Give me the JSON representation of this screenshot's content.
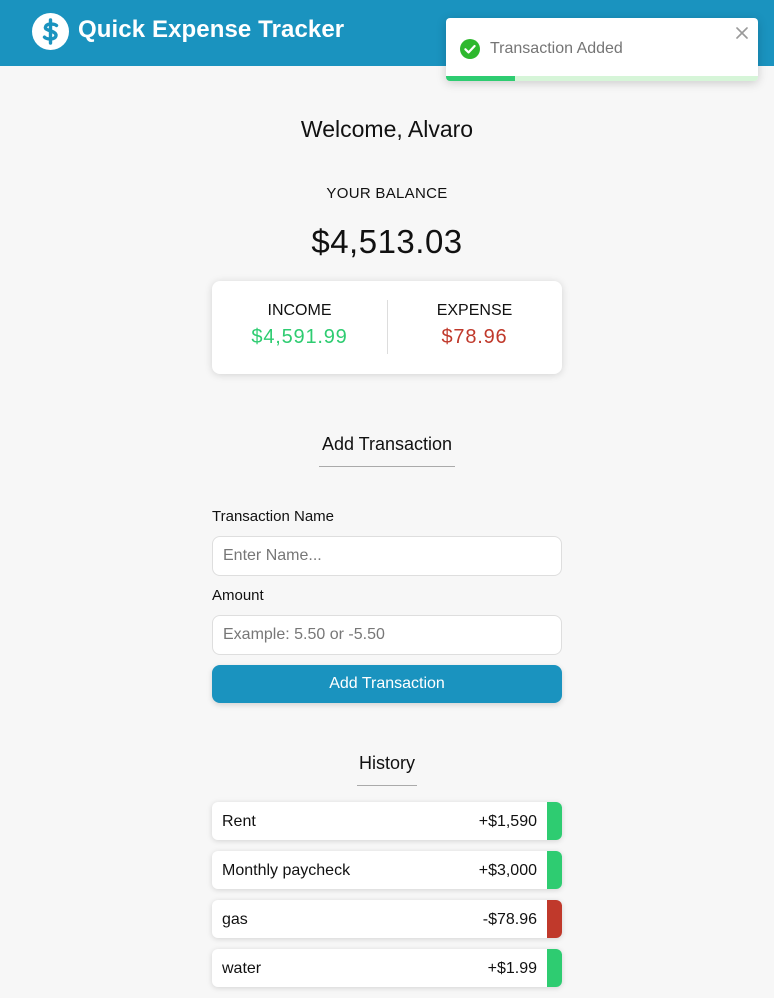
{
  "header": {
    "title": "Quick Expense Tracker",
    "logo_icon": "dollar-sign-icon",
    "color": "#1a93bf"
  },
  "toast": {
    "message": "Transaction Added",
    "icon": "check-circle-icon",
    "close_icon": "close-icon",
    "progress": 0.22,
    "accent": "#2ecc71"
  },
  "welcome": "Welcome, Alvaro",
  "balance": {
    "label": "YOUR BALANCE",
    "value": "$4,513.03"
  },
  "summary": {
    "income_label": "INCOME",
    "income_value": "$4,591.99",
    "expense_label": "EXPENSE",
    "expense_value": "$78.96",
    "income_color": "#2ecc71",
    "expense_color": "#c0392b"
  },
  "add_transaction": {
    "heading": "Add Transaction",
    "name_label": "Transaction Name",
    "name_value": "",
    "name_placeholder": "Enter Name...",
    "amount_label": "Amount",
    "amount_value": "",
    "amount_placeholder": "Example: 5.50 or -5.50",
    "button_label": "Add Transaction"
  },
  "history": {
    "heading": "History",
    "items": [
      {
        "name": "Rent",
        "amount": "+$1,590",
        "type": "income"
      },
      {
        "name": "Monthly paycheck",
        "amount": "+$3,000",
        "type": "income"
      },
      {
        "name": "gas",
        "amount": "-$78.96",
        "type": "expense"
      },
      {
        "name": "water",
        "amount": "+$1.99",
        "type": "income"
      }
    ]
  }
}
